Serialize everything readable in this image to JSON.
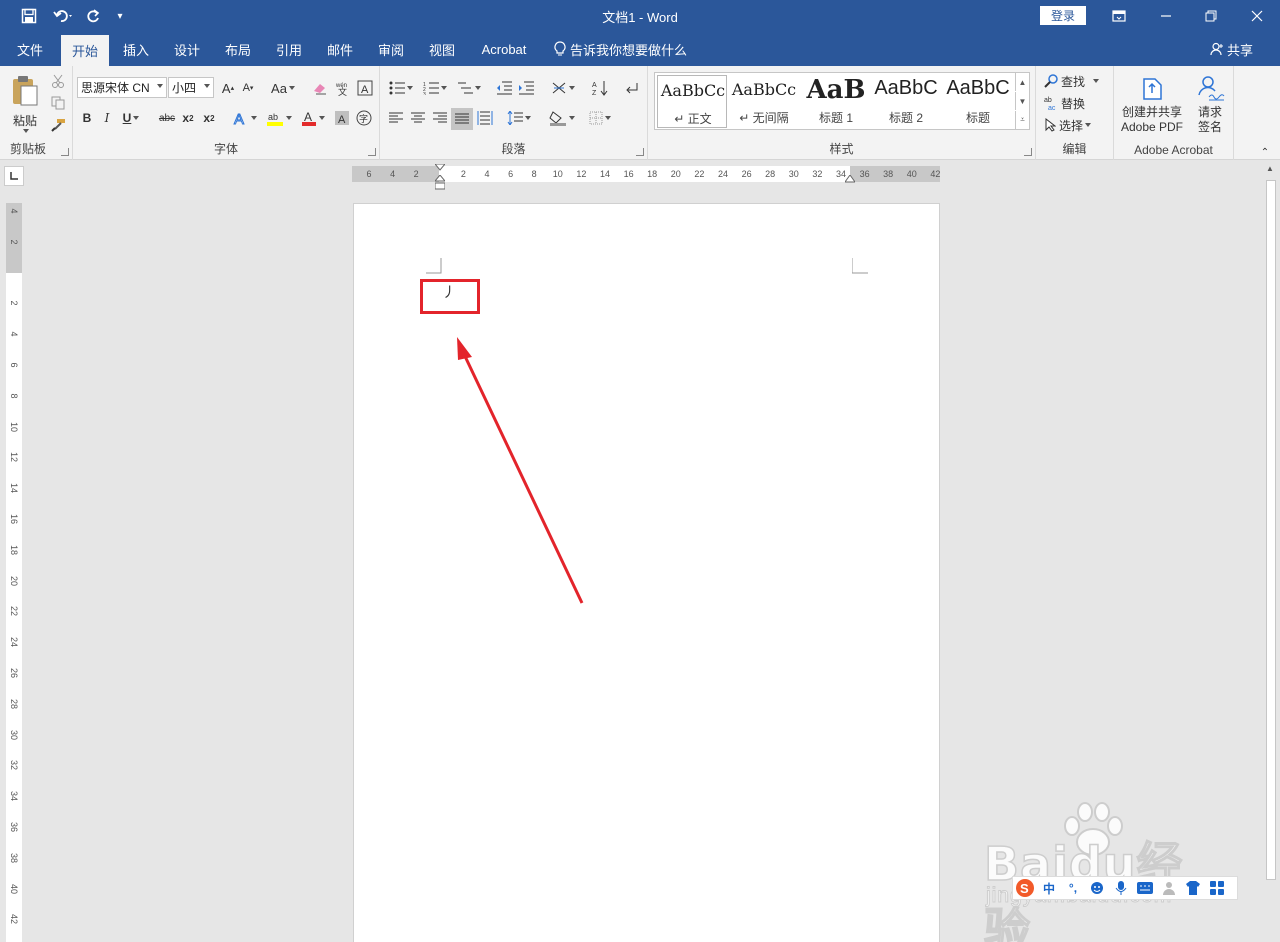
{
  "titlebar": {
    "title": "文档1  -  Word",
    "login": "登录"
  },
  "tabs": [
    {
      "label": "文件"
    },
    {
      "label": "开始"
    },
    {
      "label": "插入"
    },
    {
      "label": "设计"
    },
    {
      "label": "布局"
    },
    {
      "label": "引用"
    },
    {
      "label": "邮件"
    },
    {
      "label": "审阅"
    },
    {
      "label": "视图"
    },
    {
      "label": "Acrobat"
    }
  ],
  "tellme": "告诉我你想要做什么",
  "share": "共享",
  "ribbon": {
    "clipboard": {
      "paste": "粘贴",
      "label": "剪贴板"
    },
    "font": {
      "name": "思源宋体 CN",
      "size": "小四",
      "label": "字体",
      "change_case": "Aa"
    },
    "paragraph": {
      "label": "段落"
    },
    "styles": {
      "label": "样式",
      "items": [
        {
          "sample": "AaBbCc",
          "name": "↵ 正文"
        },
        {
          "sample": "AaBbCc",
          "name": "↵ 无间隔"
        },
        {
          "sample": "AaB",
          "name": "标题 1"
        },
        {
          "sample": "AaBbC",
          "name": "标题 2"
        },
        {
          "sample": "AaBbC",
          "name": "标题"
        }
      ]
    },
    "editing": {
      "find": "查找",
      "replace": "替换",
      "select": "选择",
      "label": "编辑"
    },
    "acrobat": {
      "create_line1": "创建并共享",
      "create_line2": "Adobe PDF",
      "request_line1": "请求",
      "request_line2": "签名",
      "label": "Adobe Acrobat"
    }
  },
  "ruler": {
    "h_ticks": [
      "6",
      "4",
      "2",
      "2",
      "4",
      "6",
      "8",
      "10",
      "12",
      "14",
      "16",
      "18",
      "20",
      "22",
      "24",
      "26",
      "28",
      "30",
      "32",
      "34",
      "36",
      "38",
      "40",
      "42"
    ],
    "v_ticks": [
      "4",
      "2",
      "2",
      "4",
      "6",
      "8",
      "10",
      "12",
      "14",
      "16",
      "18",
      "20",
      "22",
      "24",
      "26",
      "28",
      "30",
      "32",
      "34",
      "36",
      "38",
      "40",
      "42"
    ]
  },
  "document": {
    "text": "丿"
  },
  "watermark": {
    "logo": "Baidu经验",
    "url": "jingyan.baidu.com"
  },
  "ime": {
    "mode": "中"
  },
  "colors": {
    "brand": "#2b579a",
    "highlight": "#e3242b",
    "font_color": "#e32b2b",
    "highlight_color": "#ffff00"
  }
}
